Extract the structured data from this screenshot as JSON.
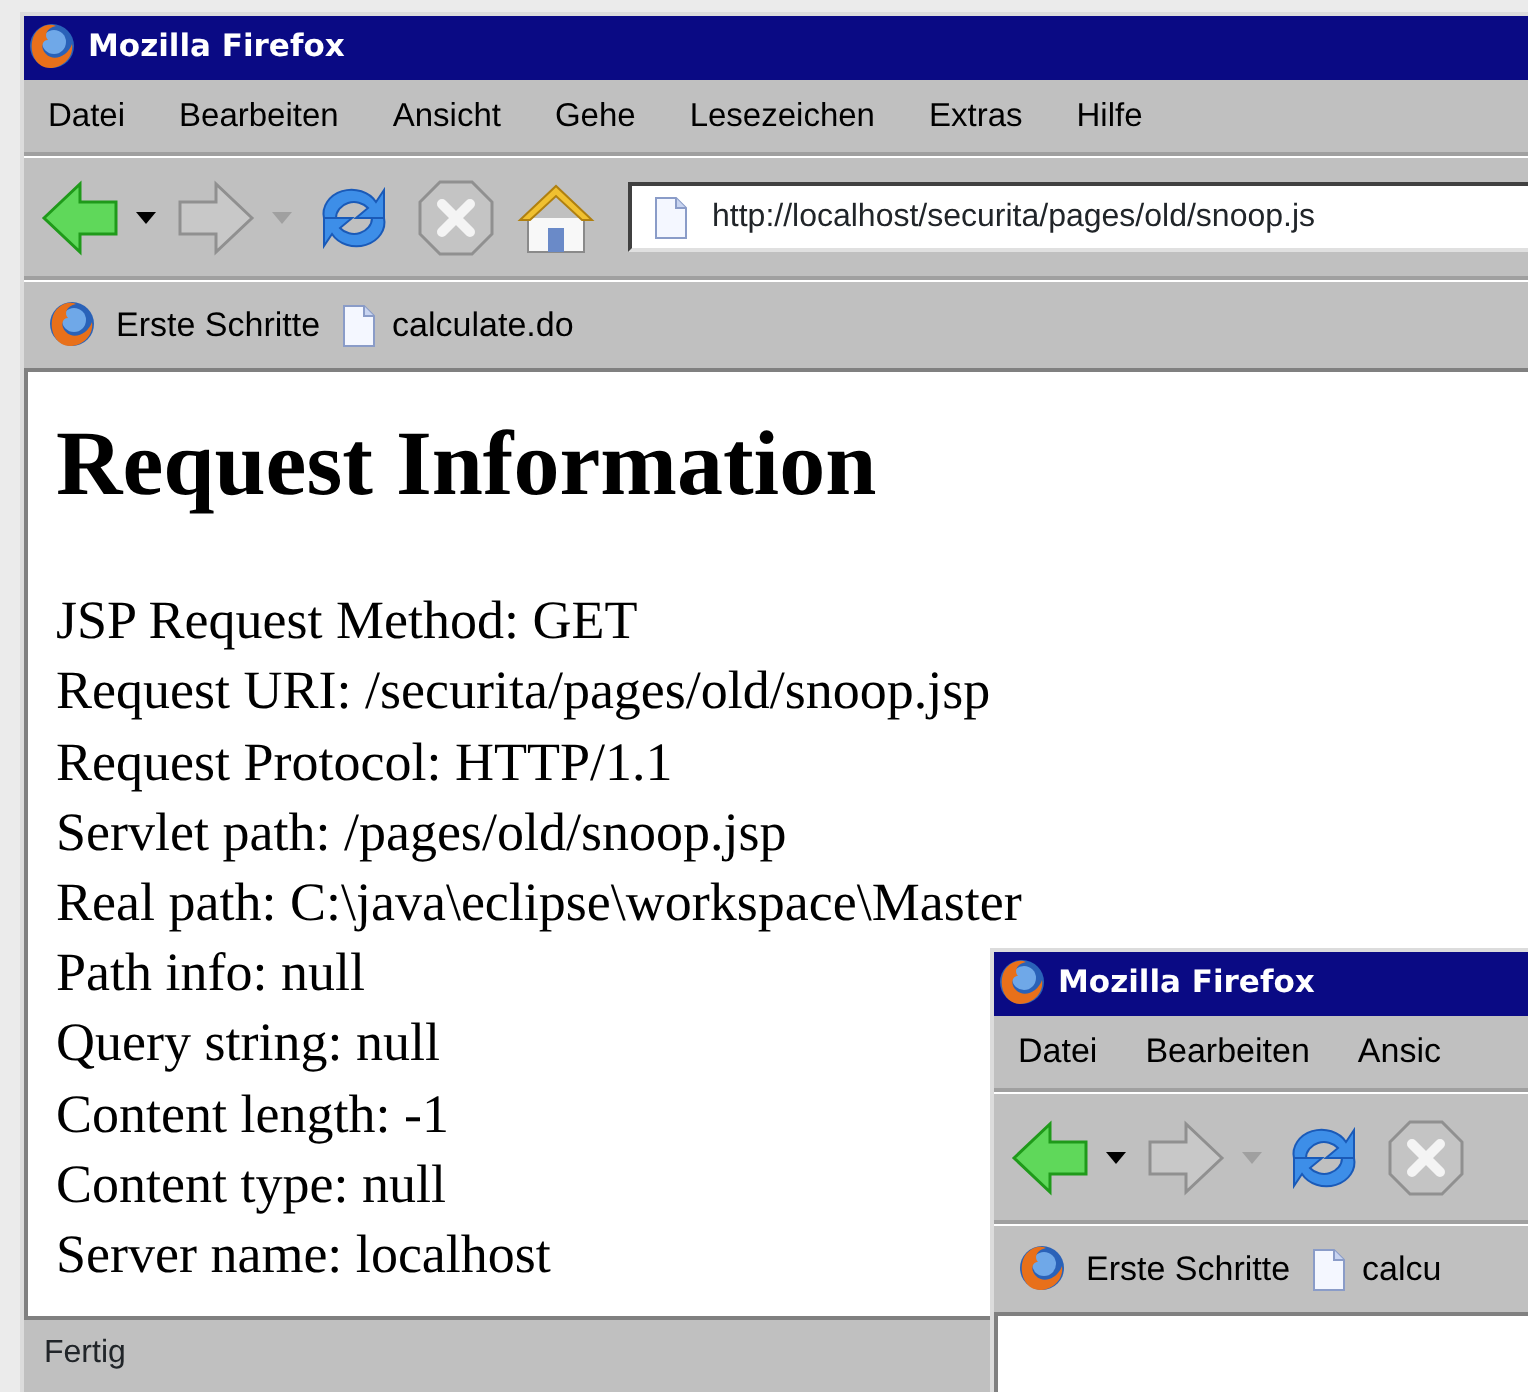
{
  "windows": [
    {
      "title": "Mozilla Firefox",
      "menu": [
        "Datei",
        "Bearbeiten",
        "Ansicht",
        "Gehe",
        "Lesezeichen",
        "Extras",
        "Hilfe"
      ],
      "toolbar": [
        {
          "kind": "back",
          "disabled": false
        },
        {
          "kind": "forward",
          "disabled": true
        },
        {
          "kind": "reload",
          "disabled": false
        },
        {
          "kind": "stop",
          "disabled": true
        },
        {
          "kind": "home",
          "disabled": false
        }
      ],
      "address": "http://localhost/securita/pages/old/snoop.js",
      "bookmarks": [
        {
          "label": "Erste Schritte",
          "kind": "firefox"
        },
        {
          "label": "calculate.do",
          "kind": "page"
        }
      ],
      "content": {
        "heading": "Request Information",
        "lines": [
          "JSP Request Method: GET",
          "Request URI: /securita/pages/old/snoop.jsp",
          "Request Protocol: HTTP/1.1",
          "Servlet path: /pages/old/snoop.jsp",
          "Real path: C:\\java\\eclipse\\workspace\\Master",
          "Path info: null",
          "Query string: null",
          "Content length: -1",
          "Content type: null",
          "Server name: localhost"
        ]
      },
      "status": "Fertig"
    },
    {
      "title": "Mozilla Firefox",
      "menu": [
        "Datei",
        "Bearbeiten",
        "Ansic"
      ],
      "toolbar": [
        {
          "kind": "back",
          "disabled": false
        },
        {
          "kind": "forward",
          "disabled": true
        },
        {
          "kind": "reload",
          "disabled": false
        },
        {
          "kind": "stop",
          "disabled": true
        }
      ],
      "bookmarks": [
        {
          "label": "Erste Schritte",
          "kind": "firefox"
        },
        {
          "label": "calcu",
          "kind": "page"
        }
      ]
    }
  ]
}
